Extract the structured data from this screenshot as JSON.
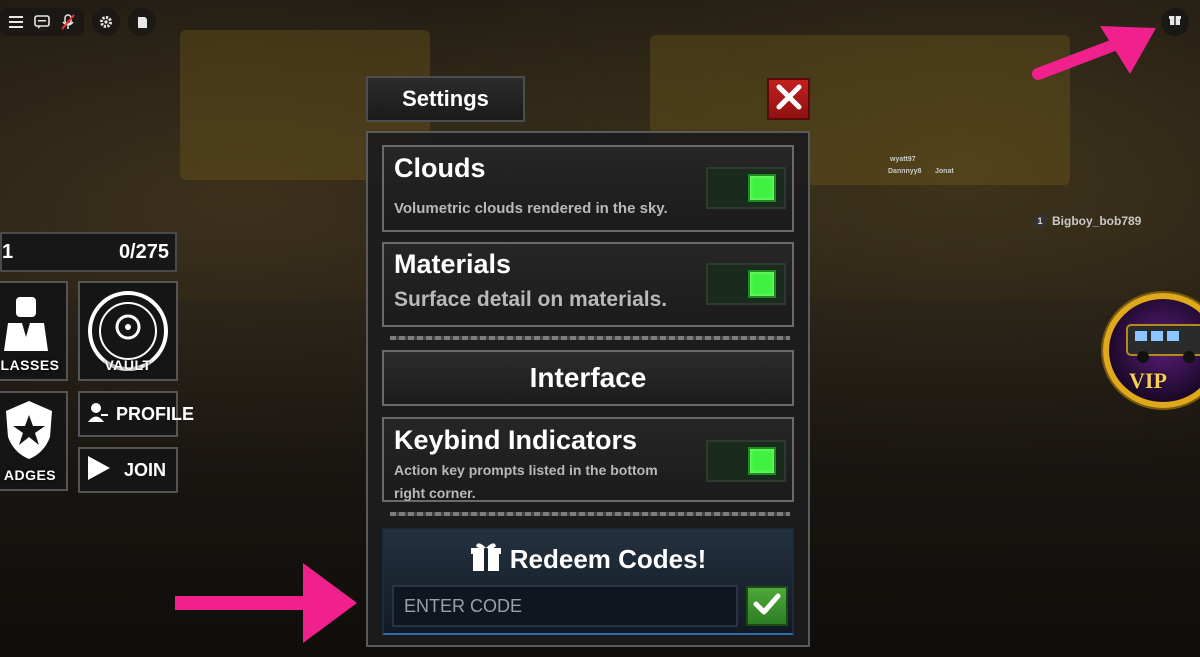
{
  "topbar": {
    "icons": [
      "menu-icon",
      "chat-icon",
      "mic-muted-icon",
      "settings-icon",
      "document-icon"
    ]
  },
  "topright": {
    "icon": "gift-icon"
  },
  "left_panel": {
    "counter_left": "1",
    "counter_right": "0/275",
    "tiles": [
      {
        "label": "LASSES",
        "icon": "suit-person-icon"
      },
      {
        "label": "VAULT",
        "icon": "vault-icon"
      },
      {
        "label": "ADGES",
        "icon": "star-shield-icon"
      }
    ],
    "profile_label": "PROFILE",
    "join_label": "JOIN"
  },
  "settings": {
    "tab_label": "Settings",
    "close_icon": "close-icon",
    "items": [
      {
        "title": "Clouds",
        "desc": "Volumetric clouds rendered in the sky.",
        "enabled": true
      },
      {
        "title": "Materials",
        "desc": "Surface detail on materials.",
        "enabled": true
      }
    ],
    "section_header": "Interface",
    "interface_items": [
      {
        "title": "Keybind Indicators",
        "desc": "Action key prompts listed in the bottom right corner.",
        "enabled": true
      }
    ],
    "redeem": {
      "title": "Redeem Codes!",
      "placeholder": "ENTER CODE",
      "submit_icon": "checkmark-icon"
    }
  },
  "players": [
    {
      "name": "Bigboy_bob789",
      "level": "1"
    },
    {
      "name": "wyatt97",
      "level": ""
    },
    {
      "name": "Dannnyy8",
      "level": ""
    },
    {
      "name": "Jonat",
      "level": ""
    }
  ],
  "vip_badge": {
    "label": "VIP"
  },
  "colors": {
    "toggle_on": "#3ff23f",
    "close": "#c3201e",
    "submit": "#4ea83a",
    "arrow": "#f0208c",
    "vip_gold": "#e0a81b"
  }
}
